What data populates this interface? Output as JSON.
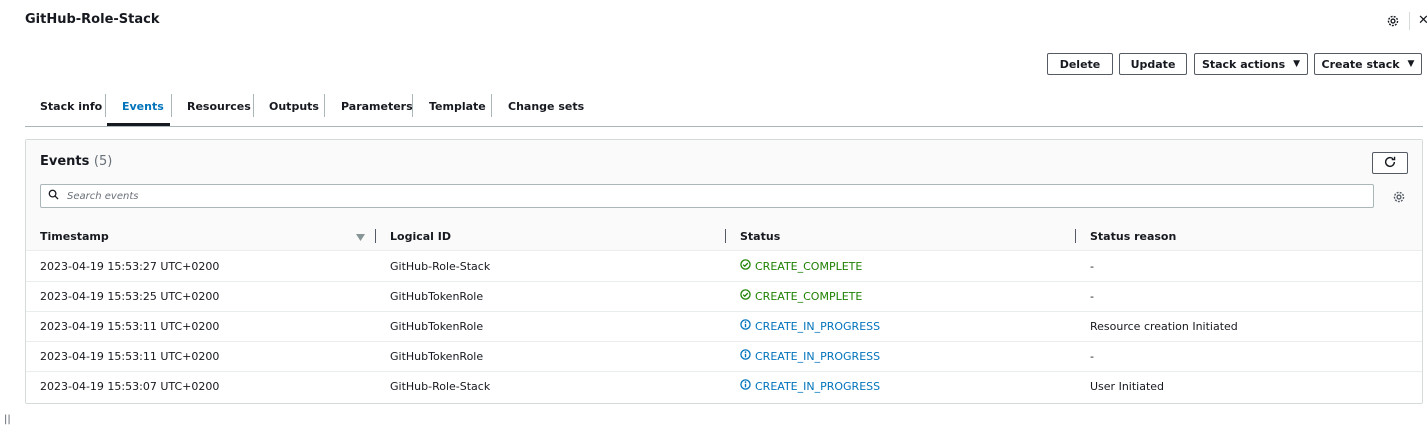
{
  "page": {
    "title": "GitHub-Role-Stack"
  },
  "actions": {
    "delete": "Delete",
    "update": "Update",
    "stack_actions": "Stack actions",
    "create_stack": "Create stack"
  },
  "tabs": [
    {
      "label": "Stack info",
      "active": false
    },
    {
      "label": "Events",
      "active": true
    },
    {
      "label": "Resources",
      "active": false
    },
    {
      "label": "Outputs",
      "active": false
    },
    {
      "label": "Parameters",
      "active": false
    },
    {
      "label": "Template",
      "active": false
    },
    {
      "label": "Change sets",
      "active": false
    }
  ],
  "events": {
    "title": "Events",
    "count": "(5)",
    "search_placeholder": "Search events",
    "columns": {
      "timestamp": "Timestamp",
      "logical_id": "Logical ID",
      "status": "Status",
      "status_reason": "Status reason"
    },
    "rows": [
      {
        "timestamp": "2023-04-19 15:53:27 UTC+0200",
        "logical_id": "GitHub-Role-Stack",
        "status": "CREATE_COMPLETE",
        "status_type": "complete",
        "reason": "-"
      },
      {
        "timestamp": "2023-04-19 15:53:25 UTC+0200",
        "logical_id": "GitHubTokenRole",
        "status": "CREATE_COMPLETE",
        "status_type": "complete",
        "reason": "-"
      },
      {
        "timestamp": "2023-04-19 15:53:11 UTC+0200",
        "logical_id": "GitHubTokenRole",
        "status": "CREATE_IN_PROGRESS",
        "status_type": "progress",
        "reason": "Resource creation Initiated"
      },
      {
        "timestamp": "2023-04-19 15:53:11 UTC+0200",
        "logical_id": "GitHubTokenRole",
        "status": "CREATE_IN_PROGRESS",
        "status_type": "progress",
        "reason": "-"
      },
      {
        "timestamp": "2023-04-19 15:53:07 UTC+0200",
        "logical_id": "GitHub-Role-Stack",
        "status": "CREATE_IN_PROGRESS",
        "status_type": "progress",
        "reason": "User Initiated"
      }
    ]
  },
  "icons": {
    "settings": "gear-icon",
    "close": "close-icon",
    "refresh": "refresh-icon",
    "search": "search-icon",
    "sort": "sort-descending-icon",
    "complete": "check-circle-icon",
    "progress": "info-circle-icon"
  },
  "colors": {
    "accent": "#0073bb",
    "success": "#1d8102",
    "text": "#16191f",
    "muted": "#687078",
    "border": "#545b64"
  }
}
